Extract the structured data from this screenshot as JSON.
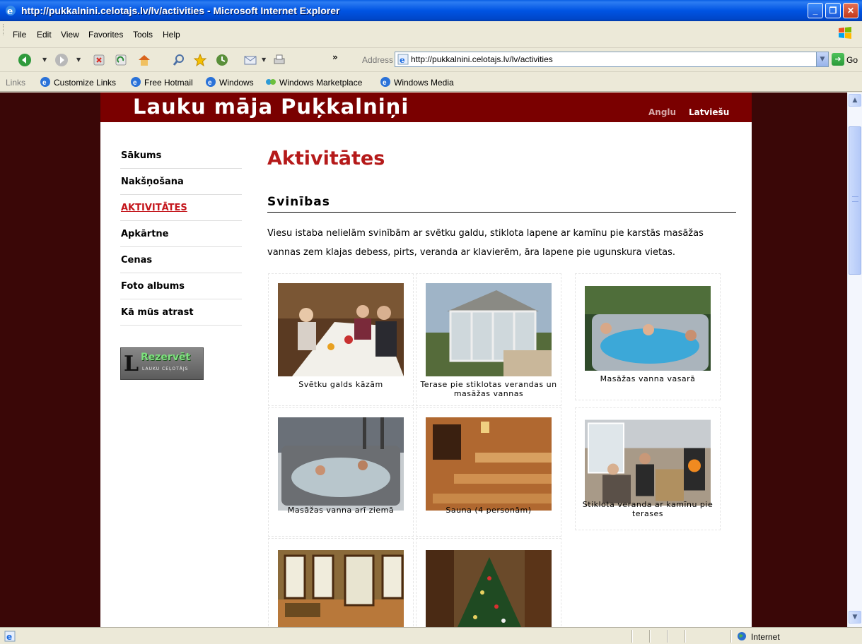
{
  "window": {
    "title": "http://pukkalnini.celotajs.lv/lv/activities - Microsoft Internet Explorer"
  },
  "menu": {
    "items": [
      "File",
      "Edit",
      "View",
      "Favorites",
      "Tools",
      "Help"
    ]
  },
  "toolbar": {
    "address_label": "Address",
    "url": "http://pukkalnini.celotajs.lv/lv/activities",
    "go_label": "Go",
    "chevron": "»"
  },
  "links_bar": {
    "label": "Links",
    "items": [
      "Customize Links",
      "Free Hotmail",
      "Windows",
      "Windows Marketplace",
      "Windows Media"
    ]
  },
  "site": {
    "title": "Lauku māja Puķkalniņi",
    "languages": [
      "Anglu",
      "Latviešu"
    ],
    "nav": [
      "Sākums",
      "Nakšņošana",
      "AKTIVITĀTES",
      "Apkārtne",
      "Cenas",
      "Foto albums",
      "Kā mūs atrast"
    ],
    "active_nav": "AKTIVITĀTES",
    "booking_badge": {
      "text": "Rezervēt",
      "sub": "LAUKU CEĻOTĀJS",
      "mark": "L"
    }
  },
  "content": {
    "page_title": "Aktivitātes",
    "section_title": "Svinības",
    "intro": "Viesu istaba nelielām svinībām ar svētku galdu, stiklota lapene ar kamīnu pie karstās masāžas vannas zem klajas debess, pirts, veranda ar klavierēm, āra lapene pie ugunskura vietas.",
    "gallery": [
      {
        "caption": "Svētku galds kāzām",
        "icon": "wedding-table-photo"
      },
      {
        "caption": "Terase pie stiklotas verandas un masāžas vannas",
        "icon": "glass-veranda-photo"
      },
      {
        "caption": "Masāžas vanna vasarā",
        "icon": "hot-tub-summer-photo"
      },
      {
        "caption": "Masāžas vanna arī ziemā",
        "icon": "hot-tub-winter-photo"
      },
      {
        "caption": "Sauna (4 personām)",
        "icon": "sauna-photo"
      },
      {
        "caption": "Stiklota veranda ar kamīnu pie terases",
        "icon": "veranda-fireplace-photo"
      },
      {
        "caption": "",
        "icon": "dining-room-photo"
      },
      {
        "caption": "",
        "icon": "christmas-tree-photo"
      }
    ]
  },
  "status": {
    "zone": "Internet"
  },
  "colors": {
    "page_background": "#3a0707",
    "header_bar": "#7a0000",
    "accent_red": "#b51a1a",
    "xp_blue": "#0054e3"
  }
}
